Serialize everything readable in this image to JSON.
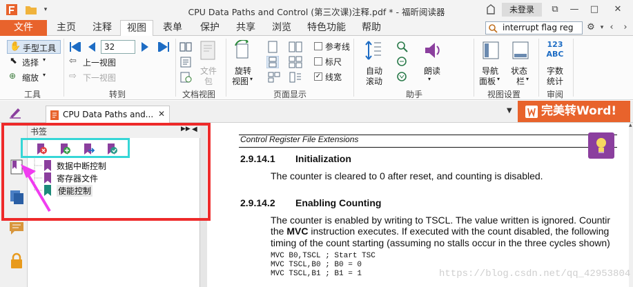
{
  "title_bar": {
    "title": "CPU Data Paths and Control (第三次课)注释.pdf * - 福昕阅读器",
    "login_label": "未登录"
  },
  "menu_tabs": [
    {
      "label": "文件"
    },
    {
      "label": "主页"
    },
    {
      "label": "注释"
    },
    {
      "label": "视图"
    },
    {
      "label": "表单"
    },
    {
      "label": "保护"
    },
    {
      "label": "共享"
    },
    {
      "label": "浏览"
    },
    {
      "label": "特色功能"
    },
    {
      "label": "帮助"
    }
  ],
  "active_tab": "视图",
  "search": {
    "value": "interrupt flag reg"
  },
  "ribbon": {
    "tools": {
      "hand_tool": "手型工具",
      "select": "选择",
      "zoom": "缩放",
      "group": "工具"
    },
    "goto": {
      "page_number": "32",
      "prev_view": "上一视图",
      "next_view": "下一视图",
      "group": "转到"
    },
    "doc_view": {
      "file_package_line1": "文件",
      "file_package_line2": "包",
      "group": "文档视图"
    },
    "page_display": {
      "rotate_line1": "旋转",
      "rotate_line2": "视图",
      "ref_lines": "参考线",
      "ruler": "标尺",
      "line_weight": "线宽",
      "group": "页面显示"
    },
    "assistant": {
      "auto_scroll_line1": "自动",
      "auto_scroll_line2": "滚动",
      "read_aloud": "朗读",
      "group": "助手"
    },
    "view_settings": {
      "nav_panel_line1": "导航",
      "nav_panel_line2": "面板",
      "status_bar_line1": "状态",
      "status_bar_line2": "栏",
      "group": "视图设置"
    },
    "review": {
      "word_count_icon": "123 ABC",
      "word_count_line1": "字数",
      "word_count_line2": "统计",
      "group": "审阅"
    }
  },
  "doc_tab": {
    "label": "CPU Data Paths and..."
  },
  "promo_button": {
    "label": "完美转Word!"
  },
  "bookmarks": {
    "title": "书签",
    "items": [
      {
        "label": "数据中断控制"
      },
      {
        "label": "寄存器文件"
      },
      {
        "label": "使能控制"
      }
    ]
  },
  "document": {
    "header": "Control Register File Extensions",
    "section1": {
      "number": "2.9.14.1",
      "title": "Initialization",
      "body": "The counter is cleared to 0 after reset, and counting is disabled."
    },
    "section2": {
      "number": "2.9.14.2",
      "title": "Enabling Counting",
      "line1": "The counter is enabled by writing to TSCL. The value written is ignored. Countir",
      "line2_pre": "the ",
      "line2_bold": "MVC",
      "line2_post": " instruction executes. If executed with the count disabled, the following",
      "line3": "timing of the count starting (assuming no stalls occur in the three cycles shown)"
    },
    "code": [
      "MVC B0,TSCL ; Start TSC",
      "MVC TSCL,B0 ; B0 = 0",
      "MVC TSCL,B1 ; B1 = 1"
    ]
  },
  "watermark": "https://blog.csdn.net/qq_42953804",
  "colors": {
    "accent": "#e8632c",
    "bookmark_purple": "#8b3f9e",
    "bookmark_teal": "#1c8a7a",
    "annotation_red": "#ee2a2a",
    "annotation_cyan": "#35d6d6",
    "arrow_magenta": "#f03cf0"
  }
}
